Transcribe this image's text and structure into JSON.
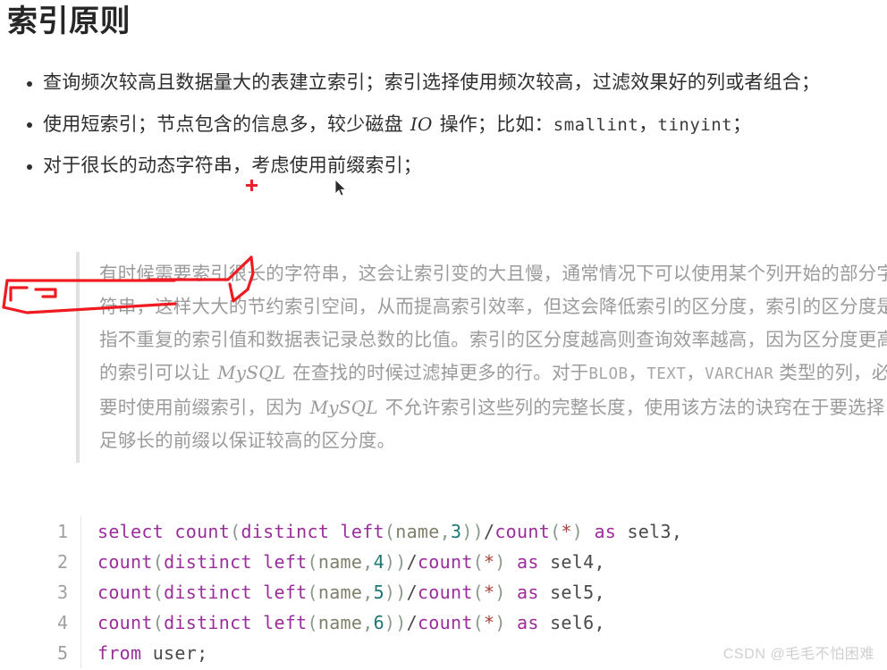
{
  "page": {
    "title": "索引原则",
    "background": "#ffffff",
    "text_color": "#2b2b2b"
  },
  "bullets": [
    {
      "id": "bullet-high-frequency-index",
      "parts": [
        {
          "type": "text",
          "value": "查询频次较高且数据量大的表建立索引；索引选择使用频次较高，过滤效果好的列或者组合；"
        }
      ]
    },
    {
      "id": "bullet-short-index",
      "parts": [
        {
          "type": "text",
          "value": "使用短索引；节点包含的信息多，较少磁盘 "
        },
        {
          "type": "italic",
          "value": "IO"
        },
        {
          "type": "text",
          "value": " 操作；比如："
        },
        {
          "type": "code",
          "value": "smallint"
        },
        {
          "type": "text",
          "value": "，"
        },
        {
          "type": "code",
          "value": "tinyint"
        },
        {
          "type": "text",
          "value": "；"
        }
      ]
    },
    {
      "id": "bullet-prefix-index",
      "parts": [
        {
          "type": "text",
          "value": "对于很长的动态字符串，考虑使用前缀索引；"
        }
      ]
    }
  ],
  "quote": {
    "id": "prefix-index-explanation",
    "border_color": "#e0e0e0",
    "text_color": "#9b9b9b",
    "parts": [
      {
        "type": "text",
        "value": "有时候需要索引很长的字符串，这会让索引变的大且慢，通常情况下可以使用某个列开始的部分字符串，这样大大的节约索引空间，从而提高索引效率，但这会降低索引的区分度，索引的区分度是指不重复的索引值和数据表记录总数的比值。索引的区分度越高则查询效率越高，因为区分度更高的索引可以让 "
      },
      {
        "type": "italic",
        "value": "MySQL"
      },
      {
        "type": "text",
        "value": " 在查找的时候过滤掉更多的行。对于"
      },
      {
        "type": "code",
        "value": "BLOB"
      },
      {
        "type": "text",
        "value": "，"
      },
      {
        "type": "code",
        "value": "TEXT"
      },
      {
        "type": "text",
        "value": "，"
      },
      {
        "type": "code",
        "value": "VARCHAR"
      },
      {
        "type": "text",
        "value": " 类型的列，必要时使用前缀索引，因为 "
      },
      {
        "type": "italic",
        "value": "MySQL"
      },
      {
        "type": "text",
        "value": " 不允许索引这些列的完整长度，使用该方法的诀窍在于要选择足够长的前缀以保证较高的区分度。"
      }
    ]
  },
  "code_block": {
    "language": "sql",
    "line_number_color": "#a0a0a0",
    "keyword_color": "#9b2d9b",
    "number_color": "#1d7874",
    "identifier_color": "#7f7f6b",
    "lines": [
      {
        "number": "1",
        "plain": "select count(distinct left(name,3))/count(*) as sel3,",
        "tokens": [
          {
            "t": "kw",
            "v": "select"
          },
          {
            "t": "op",
            "v": " "
          },
          {
            "t": "kw",
            "v": "count"
          },
          {
            "t": "pun",
            "v": "("
          },
          {
            "t": "kw",
            "v": "distinct"
          },
          {
            "t": "op",
            "v": " "
          },
          {
            "t": "kw",
            "v": "left"
          },
          {
            "t": "pun",
            "v": "("
          },
          {
            "t": "id",
            "v": "name"
          },
          {
            "t": "pun",
            "v": ","
          },
          {
            "t": "num",
            "v": "3"
          },
          {
            "t": "pun",
            "v": "))"
          },
          {
            "t": "op",
            "v": "/"
          },
          {
            "t": "kw",
            "v": "count"
          },
          {
            "t": "pun",
            "v": "("
          },
          {
            "t": "star",
            "v": "*"
          },
          {
            "t": "pun",
            "v": ")"
          },
          {
            "t": "op",
            "v": " "
          },
          {
            "t": "kw",
            "v": "as"
          },
          {
            "t": "op",
            "v": " sel3,"
          }
        ]
      },
      {
        "number": "2",
        "plain": "count(distinct left(name,4))/count(*) as sel4,",
        "tokens": [
          {
            "t": "kw",
            "v": "count"
          },
          {
            "t": "pun",
            "v": "("
          },
          {
            "t": "kw",
            "v": "distinct"
          },
          {
            "t": "op",
            "v": " "
          },
          {
            "t": "kw",
            "v": "left"
          },
          {
            "t": "pun",
            "v": "("
          },
          {
            "t": "id",
            "v": "name"
          },
          {
            "t": "pun",
            "v": ","
          },
          {
            "t": "num",
            "v": "4"
          },
          {
            "t": "pun",
            "v": "))"
          },
          {
            "t": "op",
            "v": "/"
          },
          {
            "t": "kw",
            "v": "count"
          },
          {
            "t": "pun",
            "v": "("
          },
          {
            "t": "star",
            "v": "*"
          },
          {
            "t": "pun",
            "v": ")"
          },
          {
            "t": "op",
            "v": " "
          },
          {
            "t": "kw",
            "v": "as"
          },
          {
            "t": "op",
            "v": " sel4,"
          }
        ]
      },
      {
        "number": "3",
        "plain": "count(distinct left(name,5))/count(*) as sel5,",
        "tokens": [
          {
            "t": "kw",
            "v": "count"
          },
          {
            "t": "pun",
            "v": "("
          },
          {
            "t": "kw",
            "v": "distinct"
          },
          {
            "t": "op",
            "v": " "
          },
          {
            "t": "kw",
            "v": "left"
          },
          {
            "t": "pun",
            "v": "("
          },
          {
            "t": "id",
            "v": "name"
          },
          {
            "t": "pun",
            "v": ","
          },
          {
            "t": "num",
            "v": "5"
          },
          {
            "t": "pun",
            "v": "))"
          },
          {
            "t": "op",
            "v": "/"
          },
          {
            "t": "kw",
            "v": "count"
          },
          {
            "t": "pun",
            "v": "("
          },
          {
            "t": "star",
            "v": "*"
          },
          {
            "t": "pun",
            "v": ")"
          },
          {
            "t": "op",
            "v": " "
          },
          {
            "t": "kw",
            "v": "as"
          },
          {
            "t": "op",
            "v": " sel5,"
          }
        ]
      },
      {
        "number": "4",
        "plain": "count(distinct left(name,6))/count(*) as sel6,",
        "tokens": [
          {
            "t": "kw",
            "v": "count"
          },
          {
            "t": "pun",
            "v": "("
          },
          {
            "t": "kw",
            "v": "distinct"
          },
          {
            "t": "op",
            "v": " "
          },
          {
            "t": "kw",
            "v": "left"
          },
          {
            "t": "pun",
            "v": "("
          },
          {
            "t": "id",
            "v": "name"
          },
          {
            "t": "pun",
            "v": ","
          },
          {
            "t": "num",
            "v": "6"
          },
          {
            "t": "pun",
            "v": "))"
          },
          {
            "t": "op",
            "v": "/"
          },
          {
            "t": "kw",
            "v": "count"
          },
          {
            "t": "pun",
            "v": "("
          },
          {
            "t": "star",
            "v": "*"
          },
          {
            "t": "pun",
            "v": ")"
          },
          {
            "t": "op",
            "v": " "
          },
          {
            "t": "kw",
            "v": "as"
          },
          {
            "t": "op",
            "v": " sel6,"
          }
        ]
      },
      {
        "number": "5",
        "plain": "from user;",
        "tokens": [
          {
            "t": "kw",
            "v": "from"
          },
          {
            "t": "op",
            "v": " user;"
          }
        ]
      }
    ]
  },
  "annotations": {
    "ink_color": "#ee1c22",
    "highlight_note": "列开始的部分",
    "plus_marker_color": "#e8232a"
  },
  "watermark": {
    "text": "CSDN @毛毛不怕困难",
    "color": "#cfcfcf"
  }
}
